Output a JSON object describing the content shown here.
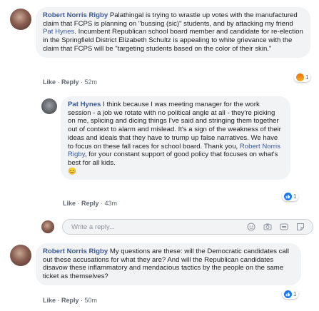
{
  "comments": [
    {
      "author": "Robert Norris Rigby",
      "text_1": " Palathingal is trying to wrastle up votes with the manufactured claim that FCPS is planning on \"bussing (sic)\" students, and by attacking my friend ",
      "mention": "Pat Hynes",
      "text_2": ". Incumbent Republican school board member and candidate for re-election in the Springfield District Elizabeth Schultz is appealing to white grievance with the claim that FCPS will be \"targeting students based on the color of their skin.\"",
      "like": "Like",
      "reply": "Reply",
      "time": "52m",
      "reaction_count": "1"
    },
    {
      "author": "Pat Hynes",
      "text_1": " I think because I was meeting manager for the work session - a job we rotate with no political angle at all - they're picking on me, splicing and dicing things I've said and stringing them together out of context to alarm and mislead. It's a sign of the weakness of their ideas and ideals that they have to trump up false narratives. We have to focus on these fall races for school board. Thank you, ",
      "mention": "Robert Norris Rigby",
      "text_2": ", for your constant support of good policy that focuses on what's best for all kids.",
      "emoji": "😊",
      "like": "Like",
      "reply": "Reply",
      "time": "43m",
      "reaction_count": "1"
    },
    {
      "author": "Robert Norris Rigby",
      "text_1": " My questions are these: will the Democratic candidates call out these accusations for what they are? And will the Republican candidates disavow these inflammatory and mendacious tactics by the people on the same ticket as themselves?",
      "like": "Like",
      "reply": "Reply",
      "time": "50m",
      "reaction_count": "1"
    }
  ],
  "reply_box": {
    "placeholder": "Write a reply..."
  },
  "colors": {
    "link": "#385898",
    "bubble": "#f2f3f5",
    "like_blue": "#1877f2",
    "angry_orange": "#e9710f"
  },
  "icons": [
    "emoji-icon",
    "camera-icon",
    "gif-icon",
    "sticker-icon"
  ],
  "separator": " · "
}
